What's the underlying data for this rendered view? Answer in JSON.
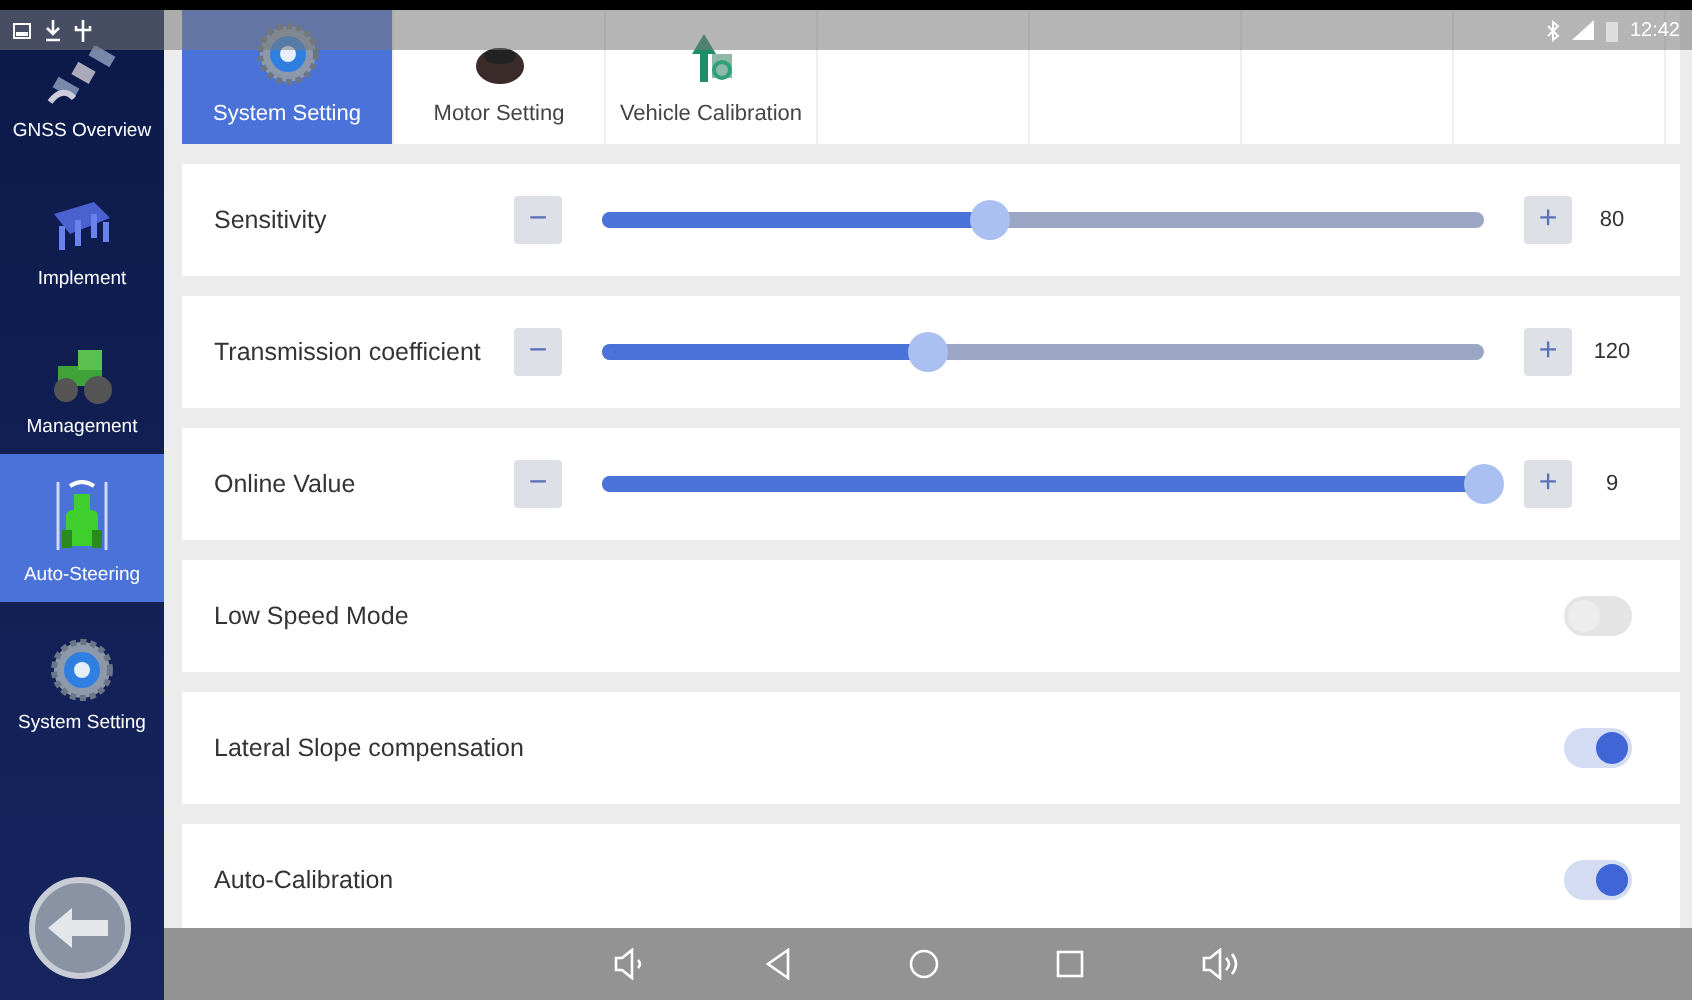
{
  "status_bar": {
    "time": "12:42"
  },
  "sidebar": {
    "items": [
      {
        "label": "GNSS Overview",
        "selected": false
      },
      {
        "label": "Implement",
        "selected": false
      },
      {
        "label": "Management",
        "selected": false
      },
      {
        "label": "Auto-Steering",
        "selected": true
      },
      {
        "label": "System Setting",
        "selected": false
      }
    ]
  },
  "tabs": [
    {
      "label": "System Setting",
      "selected": true
    },
    {
      "label": "Motor Setting",
      "selected": false
    },
    {
      "label": "Vehicle Calibration",
      "selected": false
    }
  ],
  "settings": [
    {
      "kind": "slider",
      "label": "Sensitivity",
      "level": 0.44,
      "reading": "80",
      "minus": "−",
      "plus": "+"
    },
    {
      "kind": "slider",
      "label": "Transmission coefficient",
      "level": 0.37,
      "reading": "120",
      "minus": "−",
      "plus": "+"
    },
    {
      "kind": "slider",
      "label": "Online Value",
      "level": 1.0,
      "reading": "9",
      "minus": "−",
      "plus": "+"
    },
    {
      "kind": "switch",
      "label": "Low Speed Mode",
      "on": false
    },
    {
      "kind": "switch",
      "label": "Lateral Slope compensation",
      "on": true
    },
    {
      "kind": "switch",
      "label": "Auto-Calibration",
      "on": true
    }
  ]
}
